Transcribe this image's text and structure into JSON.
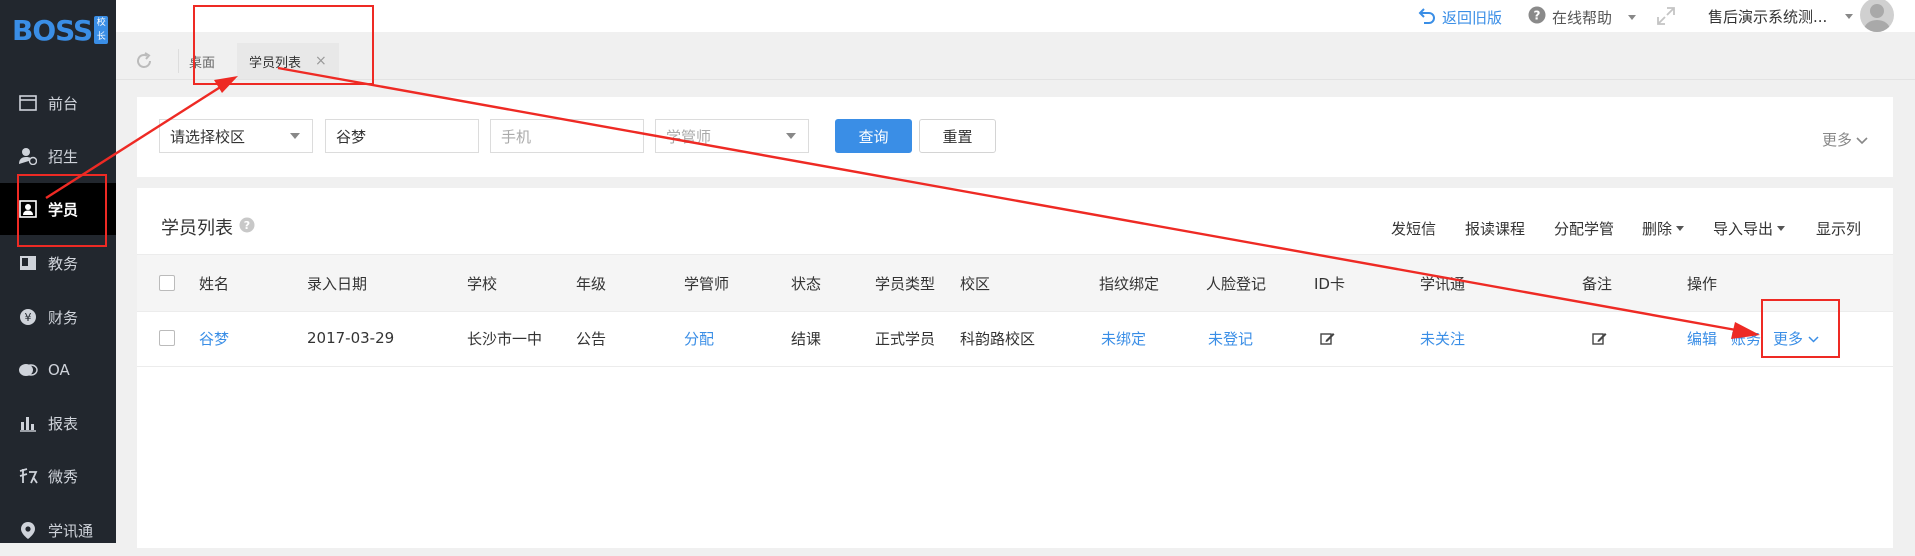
{
  "logo": {
    "text": "BOSS",
    "tag": "校长"
  },
  "sidebar": {
    "items": [
      {
        "label": "前台",
        "icon": "desk-icon",
        "active": false
      },
      {
        "label": "招生",
        "icon": "user-plus-icon",
        "active": false
      },
      {
        "label": "学员",
        "icon": "student-card-icon",
        "active": true
      },
      {
        "label": "教务",
        "icon": "book-icon",
        "active": false
      },
      {
        "label": "财务",
        "icon": "yen-icon",
        "active": false
      },
      {
        "label": "OA",
        "icon": "chat-icon",
        "active": false
      },
      {
        "label": "报表",
        "icon": "bar-chart-icon",
        "active": false
      },
      {
        "label": "微秀",
        "icon": "xiu-icon",
        "active": false
      },
      {
        "label": "学讯通",
        "icon": "location-pin-icon",
        "active": false
      }
    ]
  },
  "header": {
    "back_old": "返回旧版",
    "help": "在线帮助",
    "user": "售后演示系统测..."
  },
  "tabs": {
    "items": [
      {
        "label": "桌面",
        "active": false
      },
      {
        "label": "学员列表",
        "active": true,
        "close": "×"
      }
    ]
  },
  "filter": {
    "campus_placeholder": "请选择校区",
    "name_value": "谷梦",
    "phone_placeholder": "手机",
    "manager_placeholder": "学管师",
    "search_label": "查询",
    "reset_label": "重置",
    "more_label": "更多"
  },
  "list": {
    "title": "学员列表",
    "toolbar": {
      "send_sms": "发短信",
      "enroll": "报读课程",
      "assign_manager": "分配学管",
      "delete": "删除",
      "import_export": "导入导出",
      "columns": "显示列"
    },
    "columns": [
      "姓名",
      "录入日期",
      "学校",
      "年级",
      "学管师",
      "状态",
      "学员类型",
      "校区",
      "指纹绑定",
      "人脸登记",
      "ID卡",
      "学讯通",
      "备注",
      "操作"
    ],
    "rows": [
      {
        "name": "谷梦",
        "date": "2017-03-29",
        "school": "长沙市一中",
        "grade": "公告",
        "manager": "分配",
        "status": "结课",
        "type": "正式学员",
        "campus": "科韵路校区",
        "fingerprint": "未绑定",
        "face": "未登记",
        "notify": "未关注",
        "actions": {
          "edit": "编辑",
          "account": "账务",
          "more": "更多"
        }
      }
    ]
  },
  "colors": {
    "sidebar_bg": "#22272e",
    "accent": "#3a8ee6",
    "annotation_red": "#ee2a24"
  }
}
